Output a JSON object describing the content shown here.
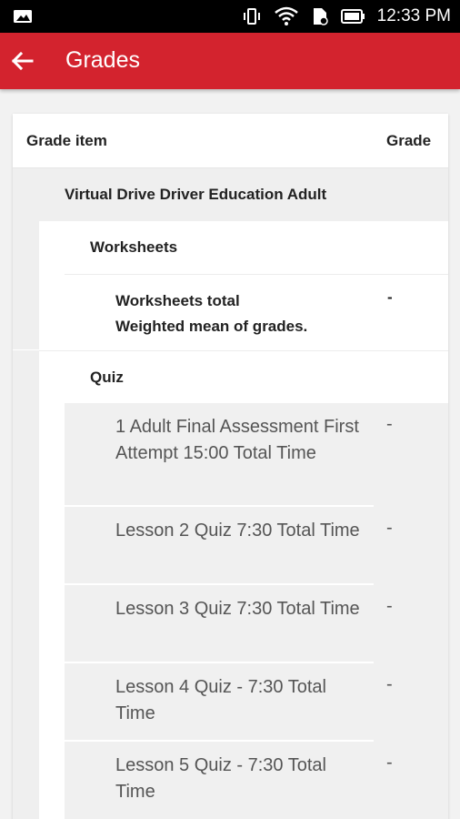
{
  "status_bar": {
    "time": "12:33 PM",
    "icons": [
      "image-icon",
      "vibrate-icon",
      "wifi-icon",
      "sim-icon",
      "battery-icon"
    ]
  },
  "app_bar": {
    "title": "Grades",
    "back_icon": "arrow-back-icon",
    "color": "#d3232e"
  },
  "table": {
    "col_item": "Grade item",
    "col_grade": "Grade",
    "course": "Virtual Drive Driver Education Adult",
    "categories": [
      {
        "name": "Worksheets",
        "total": {
          "line1": "Worksheets total",
          "line2": "Weighted mean of grades.",
          "grade": "-"
        }
      },
      {
        "name": "Quiz",
        "items": [
          {
            "name": "1 Adult Final Assessment First Attempt 15:00 Total Time",
            "grade": "-"
          },
          {
            "name": "Lesson 2 Quiz 7:30 Total Time",
            "grade": "-"
          },
          {
            "name": "Lesson 3 Quiz 7:30 Total Time",
            "grade": "-"
          },
          {
            "name": "Lesson 4 Quiz - 7:30 Total Time",
            "grade": "-"
          },
          {
            "name": "Lesson 5 Quiz - 7:30 Total Time",
            "grade": "-"
          }
        ]
      }
    ]
  }
}
